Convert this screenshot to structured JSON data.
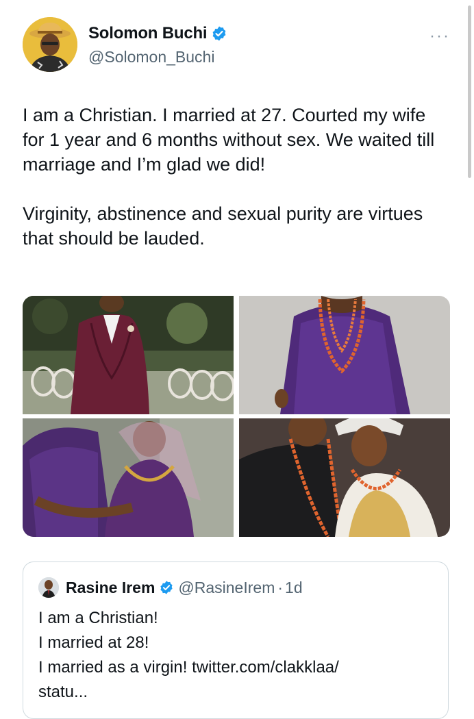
{
  "author": {
    "name": "Solomon Buchi",
    "handle": "@Solomon_Buchi"
  },
  "more_label": "···",
  "tweet": {
    "paragraphs": [
      "I am a Christian. I married at 27. Courted my wife for 1 year and 6 months without sex. We waited till marriage and I’m glad we did!",
      "Virginity, abstinence and sexual purity are virtues that should be lauded."
    ]
  },
  "media": {
    "photos": [
      "burgundy-suit-groom",
      "purple-agbada-coral-beads",
      "couple-embrace-purple",
      "couple-portrait-coral-beads"
    ]
  },
  "quoted": {
    "name": "Rasine Irem",
    "handle": "@RasineIrem",
    "separator": "·",
    "age": "1d",
    "lines": [
      "I am a Christian!",
      "I married at 28!",
      "I married as a virgin! twitter.com/clakklaa/",
      "statu..."
    ]
  },
  "colors": {
    "verified": "#1d9bf0",
    "secondary_text": "#536471",
    "border": "#cfd9de"
  }
}
